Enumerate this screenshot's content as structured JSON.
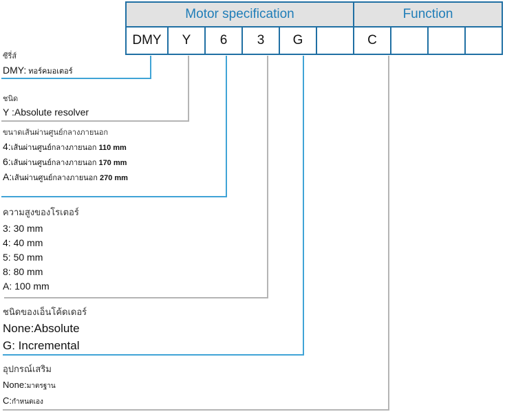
{
  "table": {
    "group_headers": [
      "Motor specification",
      "Function"
    ],
    "codes": [
      "DMY",
      "Y",
      "6",
      "3",
      "G",
      "",
      "C",
      "",
      "",
      ""
    ]
  },
  "colors": {
    "accent": "#1f7db8",
    "border": "#1f6fa3",
    "blue_line": "#3fa3d6",
    "gray_line": "#b4b4b4",
    "header_bg": "#e2e2e2"
  },
  "sections": [
    {
      "title": "ซีรี่ส์",
      "items": [
        {
          "code": "DMY:",
          "desc": " ทอร์คมอเตอร์"
        }
      ]
    },
    {
      "title": "ชนิด",
      "items": [
        {
          "code": "Y :",
          "desc": "Absolute resolver"
        }
      ]
    },
    {
      "title": "ขนาดเส้นผ่านศูนย์กลางภายนอก",
      "items": [
        {
          "code": "4:",
          "desc": "เส้นผ่านศูนย์กลางภายนอก",
          "value": " 110 mm"
        },
        {
          "code": "6:",
          "desc": "เส้นผ่านศูนย์กลางภายนอก",
          "value": " 170 mm"
        },
        {
          "code": "A:",
          "desc": "เส้นผ่านศูนย์กลางภายนอก",
          "value": " 270 mm"
        }
      ]
    },
    {
      "title": "ความสูงของโรเตอร์",
      "items": [
        {
          "text": "3: 30 mm"
        },
        {
          "text": "4: 40 mm"
        },
        {
          "text": "5: 50 mm"
        },
        {
          "text": "8: 80 mm"
        },
        {
          "text": "A: 100 mm"
        }
      ]
    },
    {
      "title": "ชนิดของเอ็นโค้ดเดอร์",
      "items": [
        {
          "text": "None:Absolute"
        },
        {
          "text": "G: Incremental"
        }
      ]
    },
    {
      "title": "อุปกรณ์เสริม",
      "items": [
        {
          "code": "None:",
          "desc": "มาตรฐาน"
        },
        {
          "code": "C:",
          "desc": "กำหนดเอง"
        }
      ]
    }
  ]
}
